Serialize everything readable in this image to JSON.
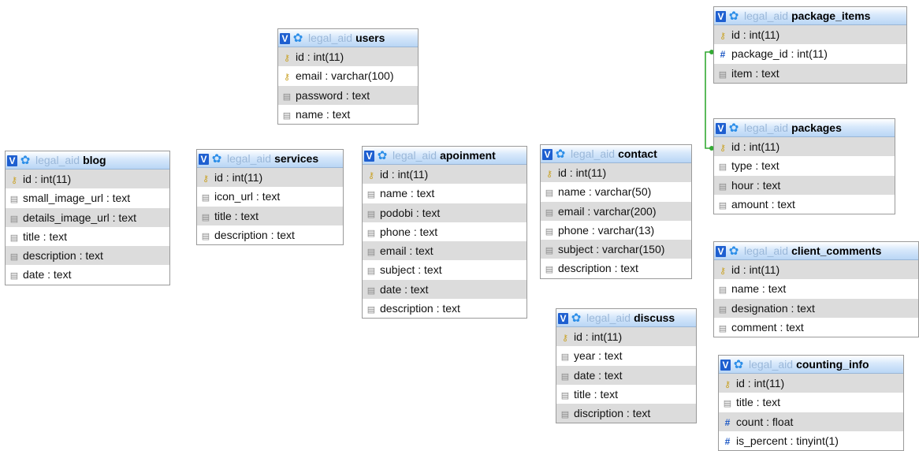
{
  "tables": [
    {
      "id": "users",
      "db": "legal_aid",
      "name": "users",
      "fields": [
        {
          "text": "id : int(11)",
          "icon": "key-icon"
        },
        {
          "text": "email : varchar(100)",
          "icon": "key-icon"
        },
        {
          "text": "password : text",
          "icon": "column-icon"
        },
        {
          "text": "name : text",
          "icon": "column-icon"
        }
      ]
    },
    {
      "id": "blog",
      "db": "legal_aid",
      "name": "blog",
      "fields": [
        {
          "text": "id : int(11)",
          "icon": "key-icon"
        },
        {
          "text": "small_image_url : text",
          "icon": "column-icon"
        },
        {
          "text": "details_image_url : text",
          "icon": "column-icon"
        },
        {
          "text": "title : text",
          "icon": "column-icon"
        },
        {
          "text": "description : text",
          "icon": "column-icon"
        },
        {
          "text": "date : text",
          "icon": "column-icon"
        }
      ]
    },
    {
      "id": "services",
      "db": "legal_aid",
      "name": "services",
      "fields": [
        {
          "text": "id : int(11)",
          "icon": "key-icon"
        },
        {
          "text": "icon_url : text",
          "icon": "column-icon"
        },
        {
          "text": "title : text",
          "icon": "column-icon"
        },
        {
          "text": "description : text",
          "icon": "column-icon"
        }
      ]
    },
    {
      "id": "apoinment",
      "db": "legal_aid",
      "name": "apoinment",
      "fields": [
        {
          "text": "id : int(11)",
          "icon": "key-icon"
        },
        {
          "text": "name : text",
          "icon": "column-icon"
        },
        {
          "text": "podobi : text",
          "icon": "column-icon"
        },
        {
          "text": "phone : text",
          "icon": "column-icon"
        },
        {
          "text": "email : text",
          "icon": "column-icon"
        },
        {
          "text": "subject : text",
          "icon": "column-icon"
        },
        {
          "text": "date : text",
          "icon": "column-icon"
        },
        {
          "text": "description : text",
          "icon": "column-icon"
        }
      ]
    },
    {
      "id": "contact",
      "db": "legal_aid",
      "name": "contact",
      "fields": [
        {
          "text": "id : int(11)",
          "icon": "key-icon"
        },
        {
          "text": "name : varchar(50)",
          "icon": "column-icon"
        },
        {
          "text": "email : varchar(200)",
          "icon": "column-icon"
        },
        {
          "text": "phone : varchar(13)",
          "icon": "column-icon"
        },
        {
          "text": "subject : varchar(150)",
          "icon": "column-icon"
        },
        {
          "text": "description : text",
          "icon": "column-icon"
        }
      ]
    },
    {
      "id": "package_items",
      "db": "legal_aid",
      "name": "package_items",
      "fields": [
        {
          "text": "id : int(11)",
          "icon": "key-icon"
        },
        {
          "text": "package_id : int(11)",
          "icon": "number-icon"
        },
        {
          "text": "item : text",
          "icon": "column-icon"
        }
      ]
    },
    {
      "id": "packages",
      "db": "legal_aid",
      "name": "packages",
      "fields": [
        {
          "text": "id : int(11)",
          "icon": "key-icon"
        },
        {
          "text": "type : text",
          "icon": "column-icon"
        },
        {
          "text": "hour : text",
          "icon": "column-icon"
        },
        {
          "text": "amount : text",
          "icon": "column-icon"
        }
      ]
    },
    {
      "id": "client_comments",
      "db": "legal_aid",
      "name": "client_comments",
      "fields": [
        {
          "text": "id : int(11)",
          "icon": "key-icon"
        },
        {
          "text": "name : text",
          "icon": "column-icon"
        },
        {
          "text": "designation : text",
          "icon": "column-icon"
        },
        {
          "text": "comment : text",
          "icon": "column-icon"
        }
      ]
    },
    {
      "id": "discuss",
      "db": "legal_aid",
      "name": "discuss",
      "fields": [
        {
          "text": "id : int(11)",
          "icon": "key-icon"
        },
        {
          "text": "year : text",
          "icon": "column-icon"
        },
        {
          "text": "date : text",
          "icon": "column-icon"
        },
        {
          "text": "title : text",
          "icon": "column-icon"
        },
        {
          "text": "discription : text",
          "icon": "column-icon"
        }
      ]
    },
    {
      "id": "counting_info",
      "db": "legal_aid",
      "name": "counting_info",
      "fields": [
        {
          "text": "id : int(11)",
          "icon": "key-icon"
        },
        {
          "text": "title : text",
          "icon": "column-icon"
        },
        {
          "text": "count : float",
          "icon": "number-icon"
        },
        {
          "text": "is_percent : tinyint(1)",
          "icon": "number-icon"
        }
      ]
    }
  ],
  "relations": [
    {
      "from": "package_items.package_id",
      "to": "packages.id",
      "color": "#33aa33"
    }
  ],
  "colors": {
    "header_db_text": "#9bb8d9",
    "row_alt": "#dcdcdc",
    "key_icon": "#c9a227",
    "number_icon": "#1a56c4",
    "link": "#33aa33"
  }
}
